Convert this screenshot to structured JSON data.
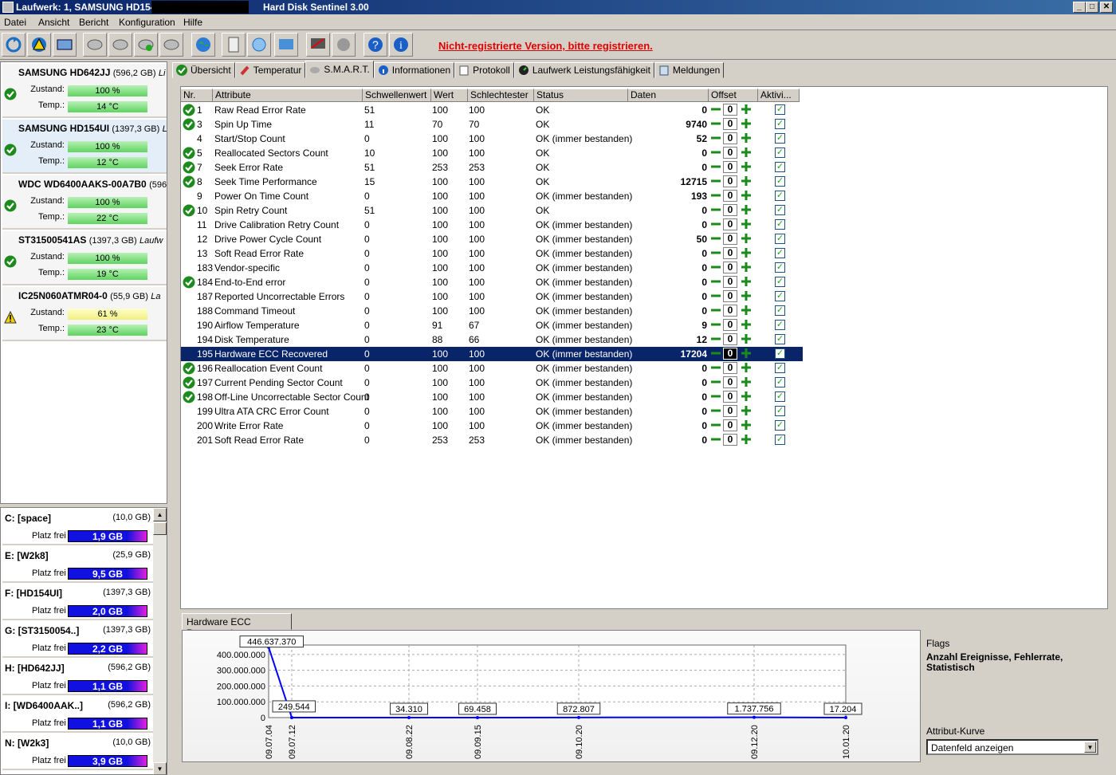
{
  "window": {
    "title_left": "Laufwerk: 1, SAMSUNG HD154UI",
    "title_app": "Hard Disk Sentinel 3.00",
    "btn_min": "_",
    "btn_max": "□",
    "btn_close": "✕"
  },
  "menu": [
    "Datei",
    "Ansicht",
    "Bericht",
    "Konfiguration",
    "Hilfe"
  ],
  "unregistered_text": "Nicht-registrierte Version, bitte registrieren.",
  "disks": [
    {
      "name": "SAMSUNG HD642JJ",
      "size": "(596,2 GB)",
      "extra": "Li",
      "zustand_label": "Zustand:",
      "zustand": "100 %",
      "temp_label": "Temp.:",
      "temp": "14 °C",
      "status": "ok"
    },
    {
      "name": "SAMSUNG HD154UI",
      "size": "(1397,3 GB)",
      "extra": "L",
      "zustand_label": "Zustand:",
      "zustand": "100 %",
      "temp_label": "Temp.:",
      "temp": "12 °C",
      "status": "ok"
    },
    {
      "name": "WDC WD6400AAKS-00A7B0",
      "size": "(596",
      "extra": "",
      "zustand_label": "Zustand:",
      "zustand": "100 %",
      "temp_label": "Temp.:",
      "temp": "22 °C",
      "status": "ok"
    },
    {
      "name": "ST31500541AS",
      "size": "(1397,3 GB)",
      "extra": "Laufw",
      "zustand_label": "Zustand:",
      "zustand": "100 %",
      "temp_label": "Temp.:",
      "temp": "19 °C",
      "status": "ok"
    },
    {
      "name": "IC25N060ATMR04-0",
      "size": "(55,9 GB)",
      "extra": "La",
      "zustand_label": "Zustand:",
      "zustand": "61 %",
      "temp_label": "Temp.:",
      "temp": "23 °C",
      "status": "warn"
    }
  ],
  "volumes": [
    {
      "name": "C: [space]",
      "size": "(10,0 GB)",
      "free_label": "Platz frei",
      "free": "1,9 GB"
    },
    {
      "name": "E: [W2k8]",
      "size": "(25,9 GB)",
      "free_label": "Platz frei",
      "free": "9,5 GB"
    },
    {
      "name": "F: [HD154UI]",
      "size": "(1397,3 GB)",
      "free_label": "Platz frei",
      "free": "2,0 GB"
    },
    {
      "name": "G: [ST3150054..]",
      "size": "(1397,3 GB)",
      "free_label": "Platz frei",
      "free": "2,2 GB"
    },
    {
      "name": "H: [HD642JJ]",
      "size": "(596,2 GB)",
      "free_label": "Platz frei",
      "free": "1,1 GB"
    },
    {
      "name": "I: [WD6400AAK..]",
      "size": "(596,2 GB)",
      "free_label": "Platz frei",
      "free": "1,1 GB"
    },
    {
      "name": "N: [W2k3]",
      "size": "(10,0 GB)",
      "free_label": "Platz frei",
      "free": "3,9 GB"
    }
  ],
  "tabs": [
    "Übersicht",
    "Temperatur",
    "S.M.A.R.T.",
    "Informationen",
    "Protokoll",
    "Laufwerk Leistungsfähigkeit",
    "Meldungen"
  ],
  "table": {
    "headers": [
      "Nr.",
      "Attribute",
      "Schwellenwert",
      "Wert",
      "Schlechtester",
      "Status",
      "Daten",
      "Offset",
      "Aktivi..."
    ],
    "rows": [
      {
        "icon": true,
        "nr": "1",
        "attr": "Raw Read Error Rate",
        "thr": "51",
        "val": "100",
        "worst": "100",
        "status": "OK",
        "data": "0",
        "offset": "0"
      },
      {
        "icon": true,
        "nr": "3",
        "attr": "Spin Up Time",
        "thr": "11",
        "val": "70",
        "worst": "70",
        "status": "OK",
        "data": "9740",
        "offset": "0"
      },
      {
        "icon": false,
        "nr": "4",
        "attr": "Start/Stop Count",
        "thr": "0",
        "val": "100",
        "worst": "100",
        "status": "OK (immer bestanden)",
        "data": "52",
        "offset": "0"
      },
      {
        "icon": true,
        "nr": "5",
        "attr": "Reallocated Sectors Count",
        "thr": "10",
        "val": "100",
        "worst": "100",
        "status": "OK",
        "data": "0",
        "offset": "0"
      },
      {
        "icon": true,
        "nr": "7",
        "attr": "Seek Error Rate",
        "thr": "51",
        "val": "253",
        "worst": "253",
        "status": "OK",
        "data": "0",
        "offset": "0"
      },
      {
        "icon": true,
        "nr": "8",
        "attr": "Seek Time Performance",
        "thr": "15",
        "val": "100",
        "worst": "100",
        "status": "OK",
        "data": "12715",
        "offset": "0"
      },
      {
        "icon": false,
        "nr": "9",
        "attr": "Power On Time Count",
        "thr": "0",
        "val": "100",
        "worst": "100",
        "status": "OK (immer bestanden)",
        "data": "193",
        "offset": "0"
      },
      {
        "icon": true,
        "nr": "10",
        "attr": "Spin Retry Count",
        "thr": "51",
        "val": "100",
        "worst": "100",
        "status": "OK",
        "data": "0",
        "offset": "0"
      },
      {
        "icon": false,
        "nr": "11",
        "attr": "Drive Calibration Retry Count",
        "thr": "0",
        "val": "100",
        "worst": "100",
        "status": "OK (immer bestanden)",
        "data": "0",
        "offset": "0"
      },
      {
        "icon": false,
        "nr": "12",
        "attr": "Drive Power Cycle Count",
        "thr": "0",
        "val": "100",
        "worst": "100",
        "status": "OK (immer bestanden)",
        "data": "50",
        "offset": "0"
      },
      {
        "icon": false,
        "nr": "13",
        "attr": "Soft Read Error Rate",
        "thr": "0",
        "val": "100",
        "worst": "100",
        "status": "OK (immer bestanden)",
        "data": "0",
        "offset": "0"
      },
      {
        "icon": false,
        "nr": "183",
        "attr": "Vendor-specific",
        "thr": "0",
        "val": "100",
        "worst": "100",
        "status": "OK (immer bestanden)",
        "data": "0",
        "offset": "0"
      },
      {
        "icon": true,
        "nr": "184",
        "attr": "End-to-End error",
        "thr": "0",
        "val": "100",
        "worst": "100",
        "status": "OK (immer bestanden)",
        "data": "0",
        "offset": "0"
      },
      {
        "icon": false,
        "nr": "187",
        "attr": "Reported Uncorrectable Errors",
        "thr": "0",
        "val": "100",
        "worst": "100",
        "status": "OK (immer bestanden)",
        "data": "0",
        "offset": "0"
      },
      {
        "icon": false,
        "nr": "188",
        "attr": "Command Timeout",
        "thr": "0",
        "val": "100",
        "worst": "100",
        "status": "OK (immer bestanden)",
        "data": "0",
        "offset": "0"
      },
      {
        "icon": false,
        "nr": "190",
        "attr": "Airflow Temperature",
        "thr": "0",
        "val": "91",
        "worst": "67",
        "status": "OK (immer bestanden)",
        "data": "9",
        "offset": "0"
      },
      {
        "icon": false,
        "nr": "194",
        "attr": "Disk Temperature",
        "thr": "0",
        "val": "88",
        "worst": "66",
        "status": "OK (immer bestanden)",
        "data": "12",
        "offset": "0"
      },
      {
        "icon": false,
        "nr": "195",
        "attr": "Hardware ECC Recovered",
        "thr": "0",
        "val": "100",
        "worst": "100",
        "status": "OK (immer bestanden)",
        "data": "17204",
        "offset": "0",
        "selected": true
      },
      {
        "icon": true,
        "nr": "196",
        "attr": "Reallocation Event Count",
        "thr": "0",
        "val": "100",
        "worst": "100",
        "status": "OK (immer bestanden)",
        "data": "0",
        "offset": "0"
      },
      {
        "icon": true,
        "nr": "197",
        "attr": "Current Pending Sector Count",
        "thr": "0",
        "val": "100",
        "worst": "100",
        "status": "OK (immer bestanden)",
        "data": "0",
        "offset": "0"
      },
      {
        "icon": true,
        "nr": "198",
        "attr": "Off-Line Uncorrectable Sector Count",
        "thr": "0",
        "val": "100",
        "worst": "100",
        "status": "OK (immer bestanden)",
        "data": "0",
        "offset": "0"
      },
      {
        "icon": false,
        "nr": "199",
        "attr": "Ultra ATA CRC Error Count",
        "thr": "0",
        "val": "100",
        "worst": "100",
        "status": "OK (immer bestanden)",
        "data": "0",
        "offset": "0"
      },
      {
        "icon": false,
        "nr": "200",
        "attr": "Write Error Rate",
        "thr": "0",
        "val": "100",
        "worst": "100",
        "status": "OK (immer bestanden)",
        "data": "0",
        "offset": "0"
      },
      {
        "icon": false,
        "nr": "201",
        "attr": "Soft Read Error Rate",
        "thr": "0",
        "val": "253",
        "worst": "253",
        "status": "OK (immer bestanden)",
        "data": "0",
        "offset": "0"
      }
    ]
  },
  "lower_tab": "Hardware ECC Recovered",
  "flags": {
    "title": "Flags",
    "value": "Anzahl Ereignisse, Fehlerrate, Statistisch",
    "attr_label": "Attribut-Kurve",
    "attr_select": "Datenfeld anzeigen"
  },
  "chart_data": {
    "type": "line",
    "x": [
      "09.07.04",
      "09.07.12",
      "09.08.22",
      "09.09.15",
      "09.10.20",
      "09.12.20",
      "10.01.20"
    ],
    "series": [
      {
        "values": [
          446637370,
          249544,
          34310,
          69458,
          872807,
          1737756,
          17204
        ]
      }
    ],
    "point_labels": [
      "446.637.370",
      "249.544",
      "34.310",
      "69.458",
      "872.807",
      "1.737.756",
      "17.204"
    ],
    "y_ticks": [
      "400.000.000",
      "300.000.000",
      "200.000.000",
      "100.000.000",
      "0"
    ],
    "ylim": [
      0,
      460000000
    ],
    "grid": true,
    "series_color": "#0000ff"
  }
}
